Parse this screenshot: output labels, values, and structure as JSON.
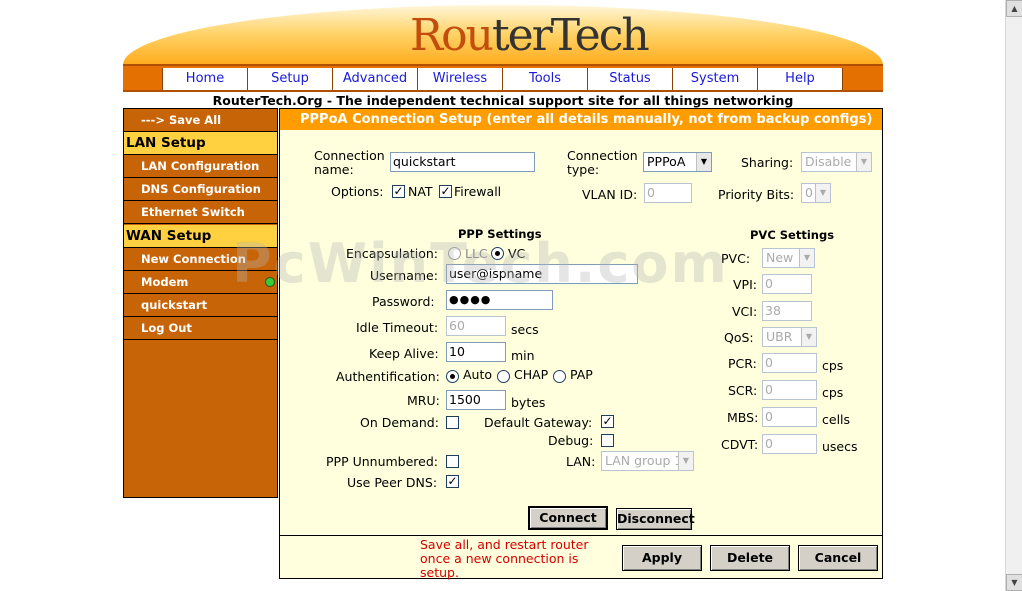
{
  "header": {
    "logo_part1": "Rou",
    "logo_part2": "ter",
    "logo_part3": "Tech",
    "tagline": "RouterTech.Org - The independent technical support site for all things networking"
  },
  "nav": [
    "Home",
    "Setup",
    "Advanced",
    "Wireless",
    "Tools",
    "Status",
    "System",
    "Help"
  ],
  "sidebar": {
    "save_all": "---> Save All",
    "lan_header": "LAN Setup",
    "lan_items": [
      "LAN Configuration",
      "DNS Configuration",
      "Ethernet Switch"
    ],
    "wan_header": "WAN Setup",
    "wan_items": [
      "New Connection",
      "Modem",
      "quickstart",
      "Log Out"
    ]
  },
  "panel": {
    "title": "PPPoA Connection Setup (enter all details manually, not from backup configs)",
    "connection_name_label_1": "Connection",
    "connection_name_label_2": "name:",
    "connection_name_value": "quickstart",
    "connection_type_label_1": "Connection",
    "connection_type_label_2": "type:",
    "connection_type_value": "PPPoA",
    "sharing_label": "Sharing:",
    "sharing_value": "Disable",
    "options_label": "Options:",
    "nat_label": "NAT",
    "firewall_label": "Firewall",
    "vlan_label": "VLAN ID:",
    "vlan_value": "0",
    "priority_label": "Priority Bits:",
    "priority_value": "0"
  },
  "ppp": {
    "heading": "PPP Settings",
    "encapsulation_label": "Encapsulation:",
    "llc_label": "LLC",
    "vc_label": "VC",
    "username_label": "Username:",
    "username_value": "user@ispname",
    "password_label": "Password:",
    "password_value": "●●●●",
    "idle_label": "Idle Timeout:",
    "idle_value": "60",
    "idle_unit": "secs",
    "keepalive_label": "Keep Alive:",
    "keepalive_value": "10",
    "keepalive_unit": "min",
    "auth_label": "Authentification:",
    "auth_auto": "Auto",
    "auth_chap": "CHAP",
    "auth_pap": "PAP",
    "mru_label": "MRU:",
    "mru_value": "1500",
    "mru_unit": "bytes",
    "ondemand_label": "On Demand:",
    "defaultgw_label": "Default Gateway:",
    "debug_label": "Debug:",
    "unnumbered_label": "PPP Unnumbered:",
    "lan_label": "LAN:",
    "lan_value": "LAN group 1",
    "peerdns_label": "Use Peer DNS:"
  },
  "pvc": {
    "heading": "PVC Settings",
    "pvc_label": "PVC:",
    "pvc_value": "New",
    "vpi_label": "VPI:",
    "vpi_value": "0",
    "vci_label": "VCI:",
    "vci_value": "38",
    "qos_label": "QoS:",
    "qos_value": "UBR",
    "pcr_label": "PCR:",
    "pcr_value": "0",
    "pcr_unit": "cps",
    "scr_label": "SCR:",
    "scr_value": "0",
    "scr_unit": "cps",
    "mbs_label": "MBS:",
    "mbs_value": "0",
    "mbs_unit": "cells",
    "cdvt_label": "CDVT:",
    "cdvt_value": "0",
    "cdvt_unit": "usecs"
  },
  "buttons": {
    "connect": "Connect",
    "disconnect": "Disconnect",
    "apply": "Apply",
    "delete": "Delete",
    "cancel": "Cancel"
  },
  "footer_note": "Save all, and restart router once a new connection is setup.",
  "watermark": "PcWinTech.com",
  "colors": {
    "accent": "#ff9d00",
    "sidebar": "#c86408",
    "panel_bg": "#ffffdd",
    "note": "#d40000"
  }
}
